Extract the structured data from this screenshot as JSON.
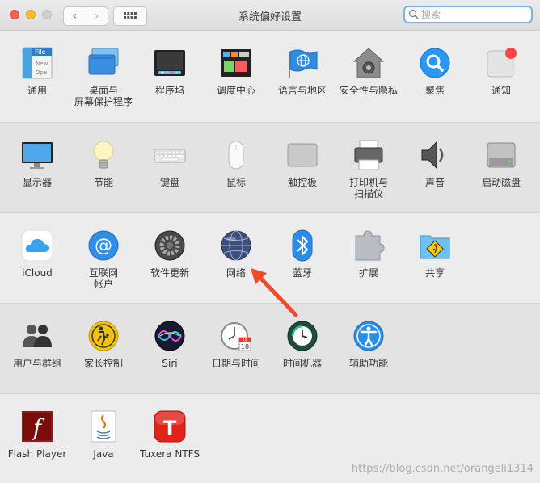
{
  "window": {
    "title": "系统偏好设置",
    "search_placeholder": "搜索"
  },
  "rows": [
    [
      {
        "label": "通用",
        "icon": "file-general-icon"
      },
      {
        "label": "桌面与\n屏幕保护程序",
        "icon": "desktop-screensaver-icon"
      },
      {
        "label": "程序坞",
        "icon": "dock-icon"
      },
      {
        "label": "调度中心",
        "icon": "mission-control-icon"
      },
      {
        "label": "语言与地区",
        "icon": "language-region-icon"
      },
      {
        "label": "安全性与隐私",
        "icon": "security-privacy-icon"
      },
      {
        "label": "聚焦",
        "icon": "spotlight-icon"
      },
      {
        "label": "通知",
        "icon": "notifications-icon"
      }
    ],
    [
      {
        "label": "显示器",
        "icon": "display-icon"
      },
      {
        "label": "节能",
        "icon": "energy-saver-icon"
      },
      {
        "label": "键盘",
        "icon": "keyboard-icon"
      },
      {
        "label": "鼠标",
        "icon": "mouse-icon"
      },
      {
        "label": "触控板",
        "icon": "trackpad-icon"
      },
      {
        "label": "打印机与\n扫描仪",
        "icon": "printer-scanner-icon"
      },
      {
        "label": "声音",
        "icon": "sound-icon"
      },
      {
        "label": "启动磁盘",
        "icon": "startup-disk-icon"
      }
    ],
    [
      {
        "label": "iCloud",
        "icon": "icloud-icon"
      },
      {
        "label": "互联网\n帐户",
        "icon": "internet-accounts-icon"
      },
      {
        "label": "软件更新",
        "icon": "software-update-icon"
      },
      {
        "label": "网络",
        "icon": "network-icon"
      },
      {
        "label": "蓝牙",
        "icon": "bluetooth-icon"
      },
      {
        "label": "扩展",
        "icon": "extensions-icon"
      },
      {
        "label": "共享",
        "icon": "sharing-icon"
      }
    ],
    [
      {
        "label": "用户与群组",
        "icon": "users-groups-icon"
      },
      {
        "label": "家长控制",
        "icon": "parental-controls-icon"
      },
      {
        "label": "Siri",
        "icon": "siri-icon"
      },
      {
        "label": "日期与时间",
        "icon": "date-time-icon"
      },
      {
        "label": "时间机器",
        "icon": "time-machine-icon"
      },
      {
        "label": "辅助功能",
        "icon": "accessibility-icon"
      }
    ],
    [
      {
        "label": "Flash Player",
        "icon": "flash-player-icon"
      },
      {
        "label": "Java",
        "icon": "java-icon"
      },
      {
        "label": "Tuxera NTFS",
        "icon": "tuxera-ntfs-icon"
      }
    ]
  ],
  "icon_text": {
    "general_file": "File",
    "general_new": "New",
    "general_ope": "Ope",
    "calendar_month": "JUL",
    "calendar_day": "18",
    "tuxera_letter": "T",
    "flash_letter": "f",
    "at_sign": "@"
  },
  "watermark": "https://blog.csdn.net/orangeli1314",
  "colors": {
    "annotation_arrow": "#f04a2a"
  }
}
